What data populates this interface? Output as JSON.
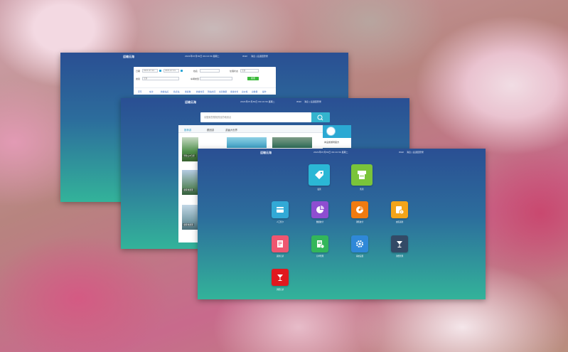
{
  "screens": {
    "s1": {
      "app_title": "运输云海",
      "datetime": "2021年07月30日 09:10:30 星期二",
      "user": "Wiki!",
      "links": "消息 | 后退回登录",
      "form": {
        "date_label": "日期",
        "date_from": "2021-07-01",
        "date_to": "2021-07-31",
        "name_label": "姓名",
        "status_label": "处理状态",
        "status_value": "全部",
        "type_label": "类别",
        "type_value": "全部",
        "vehicle_label": "车辆类型",
        "search_button": "搜索"
      },
      "tabs": [
        "序号",
        "车次",
        "始发站点",
        "终点站",
        "乘客数",
        "始发时间",
        "到站时间",
        "余票数量",
        "乘坐时长",
        "总价格",
        "总数量",
        "操作"
      ]
    },
    "s2": {
      "app_title": "运输云海",
      "datetime": "2021年07月30日 09:10:30 星期二",
      "user": "Wiki!",
      "links": "消息 | 后退回登录",
      "search_placeholder": "请搜索您想找的目的地景点",
      "panel_tabs": [
        "推荐游",
        "跟团游",
        "游遍大世界"
      ],
      "thumb_labels": [
        "普陀山3日游",
        "康辉旅游团",
        "康辉旅游团"
      ],
      "side_widget_text": "青岛旅游局官方"
    },
    "s3": {
      "app_title": "运输云海",
      "datetime": "2021年07月30日 09:10:30 星期二",
      "user": "Wiki!",
      "links": "消息 | 后退回登录",
      "apps": [
        {
          "label": "发票",
          "color": "#2bb7d5"
        },
        {
          "label": "售票",
          "color": "#7ac43a"
        },
        {
          "label": "人工售卡",
          "color": "#32a9d6"
        },
        {
          "label": "数据统计",
          "color": "#8e4ed1"
        },
        {
          "label": "销售统计",
          "color": "#f07b10"
        },
        {
          "label": "充值退款",
          "color": "#f3a419"
        },
        {
          "label": "退款记录",
          "color": "#ee5670"
        },
        {
          "label": "订单管理",
          "color": "#33b65a"
        },
        {
          "label": "系统设置",
          "color": "#2f88d8"
        },
        {
          "label": "消费管理",
          "color": "#334a66"
        },
        {
          "label": "消费记录",
          "color": "#e0181e"
        }
      ]
    }
  }
}
